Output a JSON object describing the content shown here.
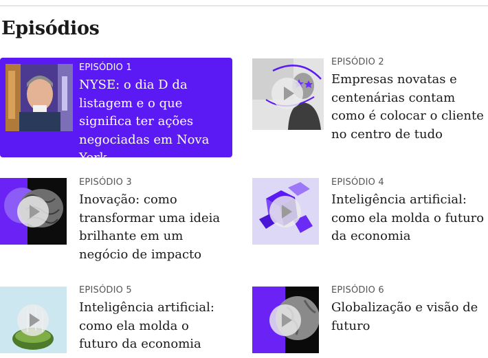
{
  "section": {
    "title": "Episódios"
  },
  "episodes": [
    {
      "label": "EPISÓDIO 1",
      "title": "NYSE: o dia D da listagem e o que significa ter ações negociadas em Nova York",
      "active": true
    },
    {
      "label": "EPISÓDIO 2",
      "title": "Empresas novatas e centenárias contam como é colocar o cliente no centro de tudo",
      "active": false
    },
    {
      "label": "EPISÓDIO 3",
      "title": "Inovação: como transformar uma ideia brilhante em um negócio de impacto",
      "active": false
    },
    {
      "label": "EPISÓDIO 4",
      "title": "Inteligência artificial: como ela molda o futuro da economia",
      "active": false
    },
    {
      "label": "EPISÓDIO 5",
      "title": "Inteligência artificial: como ela molda o futuro da economia",
      "active": false
    },
    {
      "label": "EPISÓDIO 6",
      "title": "Globalização e visão de futuro",
      "active": false
    }
  ],
  "colors": {
    "accent": "#5b19f4",
    "text": "#1a1a1a",
    "label": "#555555"
  },
  "icons": {
    "play": "play-icon"
  }
}
